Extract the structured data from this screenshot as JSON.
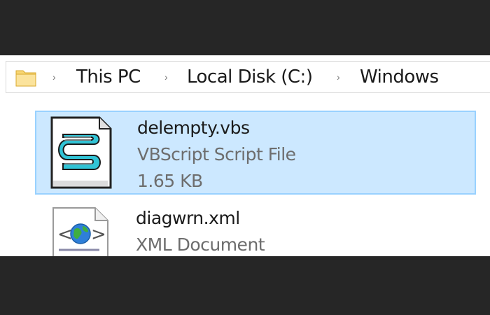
{
  "breadcrumb": {
    "separator": "›",
    "items": [
      "This PC",
      "Local Disk (C:)",
      "Windows"
    ]
  },
  "files": [
    {
      "name": "delempty.vbs",
      "type": "VBScript Script File",
      "size": "1.65 KB",
      "icon": "vbscript-file-icon",
      "selected": true
    },
    {
      "name": "diagwrn.xml",
      "type": "XML Document",
      "icon": "xml-document-icon",
      "selected": false
    }
  ],
  "colors": {
    "selection_bg": "#cce8ff",
    "selection_border": "#99d1ff",
    "folder_yellow": "#f8d775",
    "outer_bg": "#262626"
  }
}
